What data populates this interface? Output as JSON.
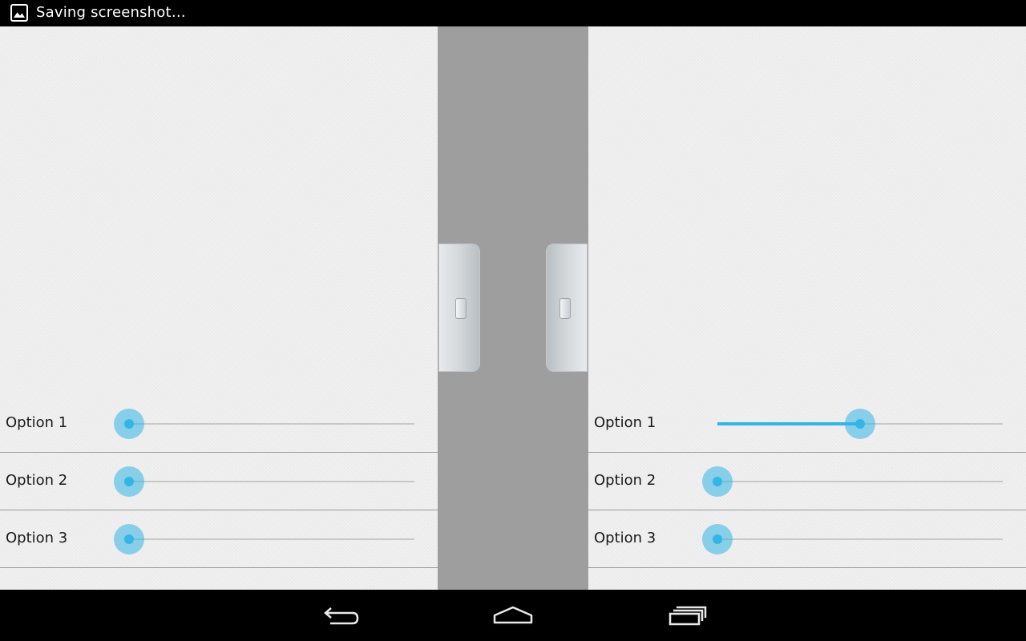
{
  "status_bar": {
    "notification_icon": "image-icon",
    "notification_text": "Saving screenshot…"
  },
  "left_panel": {
    "options": [
      {
        "label": "Option 1",
        "value": 0
      },
      {
        "label": "Option 2",
        "value": 0
      },
      {
        "label": "Option 3",
        "value": 0
      }
    ]
  },
  "right_panel": {
    "options": [
      {
        "label": "Option 1",
        "value": 0.5
      },
      {
        "label": "Option 2",
        "value": 0
      },
      {
        "label": "Option 3",
        "value": 0
      }
    ]
  },
  "nav_bar": {
    "back_icon": "back-icon",
    "home_icon": "home-icon",
    "recents_icon": "recent-apps-icon"
  },
  "colors": {
    "accent": "#33b5e5",
    "panel_background": "#f1f1f1",
    "center_background": "#9e9e9e",
    "system_bars": "#000000"
  }
}
